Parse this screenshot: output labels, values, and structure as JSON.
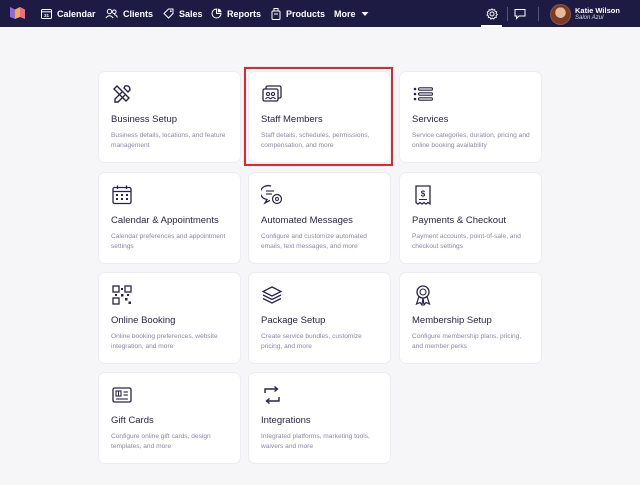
{
  "nav": {
    "items": [
      {
        "id": "calendar",
        "label": "Calendar",
        "icon": "calendar-icon"
      },
      {
        "id": "clients",
        "label": "Clients",
        "icon": "clients-icon"
      },
      {
        "id": "sales",
        "label": "Sales",
        "icon": "tag-icon"
      },
      {
        "id": "reports",
        "label": "Reports",
        "icon": "reports-icon"
      },
      {
        "id": "products",
        "label": "Products",
        "icon": "products-icon"
      },
      {
        "id": "more",
        "label": "More",
        "icon": "chevron-down-icon"
      }
    ],
    "user": {
      "name": "Katie Wilson",
      "salon": "Salon Azul"
    }
  },
  "cards": [
    {
      "title": "Business Setup",
      "desc": "Business details, locations, and feature management",
      "icon": "tools-icon"
    },
    {
      "title": "Staff Members",
      "desc": "Staff details, schedules, permissions, compensation, and more",
      "icon": "staff-icon"
    },
    {
      "title": "Services",
      "desc": "Service categories, duration, pricing and online booking availability",
      "icon": "list-icon"
    },
    {
      "title": "Calendar & Appointments",
      "desc": "Calendar preferences and appointment settings",
      "icon": "calendar-grid-icon"
    },
    {
      "title": "Automated Messages",
      "desc": "Configure and customize automated emails, text messages, and more",
      "icon": "message-gear-icon"
    },
    {
      "title": "Payments & Checkout",
      "desc": "Payment accounts, point-of-sale, and checkout settings",
      "icon": "receipt-icon"
    },
    {
      "title": "Online Booking",
      "desc": "Online booking preferences, website integration, and more",
      "icon": "qr-code-icon"
    },
    {
      "title": "Package Setup",
      "desc": "Create service bundles, customize pricing, and more",
      "icon": "layers-icon"
    },
    {
      "title": "Membership Setup",
      "desc": "Configure membership plans, pricing, and member perks",
      "icon": "badge-icon"
    },
    {
      "title": "Gift Cards",
      "desc": "Configure online gift cards, design templates, and more",
      "icon": "gift-card-icon"
    },
    {
      "title": "Integrations",
      "desc": "Integrated platforms, marketing tools, waivers and more",
      "icon": "sync-icon"
    }
  ],
  "colors": {
    "nav_bg": "#1d1b43",
    "accent": "#2a2446",
    "highlight": "#e2262c"
  }
}
